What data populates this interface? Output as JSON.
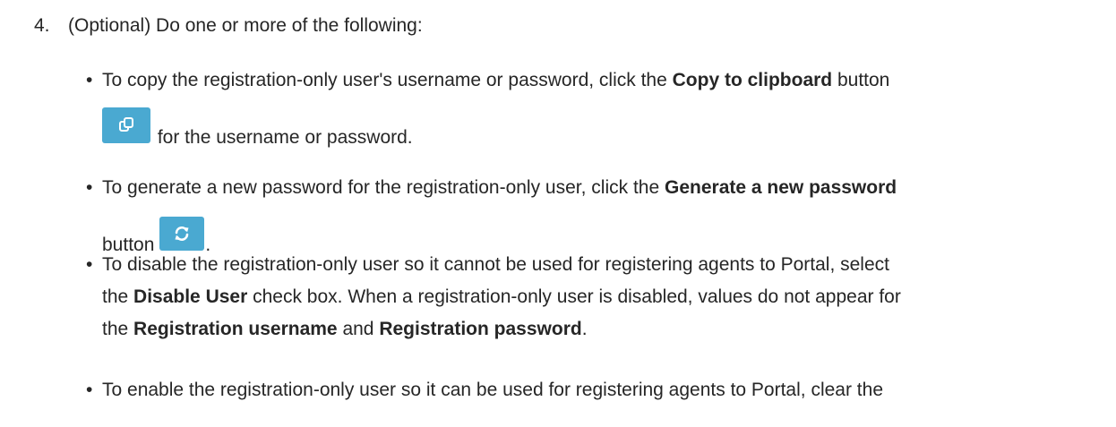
{
  "step": {
    "number": "4.",
    "text": "(Optional) Do one or more of the following:"
  },
  "bullets": [
    {
      "pre": "To copy the registration-only user's username or password, click the ",
      "bold": "Copy to clipboard",
      "post": " button",
      "after_icon": " for the username or password.",
      "icon": "copy-icon"
    },
    {
      "pre": "To generate a new password for the registration-only user, click the ",
      "bold": "Generate a new password",
      "line2_pre": "button",
      "line2_post": ".",
      "icon": "refresh-icon"
    },
    {
      "l1": "To disable the registration-only user so it cannot be used for registering agents to Portal, select",
      "l2_pre": "the ",
      "l2_bold": "Disable User",
      "l2_post": " check box. When a registration-only user is disabled, values do not appear for",
      "l3_pre": "the ",
      "l3_bold1": "Registration username",
      "l3_mid": " and ",
      "l3_bold2": "Registration password",
      "l3_post": "."
    },
    {
      "l1": "To enable the registration-only user so it can be used for registering agents to Portal, clear the"
    }
  ],
  "colors": {
    "button_bg": "#4aa9d1",
    "text": "#262626"
  }
}
